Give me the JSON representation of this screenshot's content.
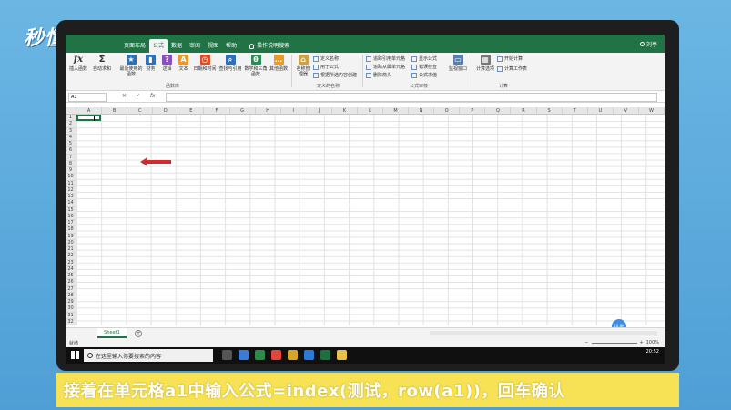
{
  "brand": {
    "logo": "秒懂视频"
  },
  "excel": {
    "tabs": [
      "页面布局",
      "公式",
      "数据",
      "审阅",
      "视图",
      "帮助"
    ],
    "active_tab": "公式",
    "tell_me": "操作说明搜索",
    "user": "刘亭",
    "ribbon": {
      "buttons": [
        {
          "label": "插入函数",
          "icon": "fx-icon"
        },
        {
          "label": "自动求和",
          "icon": "sigma-icon"
        },
        {
          "label": "最近使用的函数",
          "icon": "star-book-icon"
        },
        {
          "label": "财务",
          "icon": "book-icon"
        },
        {
          "label": "逻辑",
          "icon": "question-book-icon"
        },
        {
          "label": "文本",
          "icon": "text-book-icon"
        },
        {
          "label": "日期和时间",
          "icon": "clock-book-icon"
        },
        {
          "label": "查找与引用",
          "icon": "search-book-icon"
        },
        {
          "label": "数学和三角函数",
          "icon": "theta-book-icon"
        },
        {
          "label": "其他函数",
          "icon": "more-book-icon"
        },
        {
          "label": "名称管理器",
          "icon": "tag-icon"
        },
        {
          "label": "监视窗口",
          "icon": "watch-window-icon"
        },
        {
          "label": "计算选项",
          "icon": "calculator-icon"
        }
      ],
      "defined_names": [
        "定义名称",
        "用于公式",
        "根据所选内容创建"
      ],
      "auditing": [
        "追踪引用单元格",
        "追踪从属单元格",
        "删除箭头",
        "显示公式",
        "错误检查",
        "公式求值"
      ],
      "calc": [
        "开始计算",
        "计算工作表"
      ],
      "groups": [
        "函数库",
        "定义的名称",
        "公式审核",
        "计算"
      ]
    },
    "name_box": "A1",
    "columns": [
      "A",
      "B",
      "C",
      "D",
      "E",
      "F",
      "G",
      "H",
      "I",
      "J",
      "K",
      "L",
      "M",
      "N",
      "O",
      "P",
      "Q",
      "R",
      "S",
      "T",
      "U",
      "V",
      "W"
    ],
    "rows": [
      "1",
      "2",
      "3",
      "4",
      "5",
      "6",
      "7",
      "8",
      "9",
      "10",
      "11",
      "12",
      "13",
      "14",
      "15",
      "16",
      "17",
      "18",
      "19",
      "20",
      "21",
      "22",
      "23",
      "24",
      "25",
      "26",
      "27",
      "28",
      "29",
      "30",
      "31",
      "32"
    ],
    "sheet_tab": "Sheet1",
    "status": "就绪",
    "zoom": "100%",
    "float_button": "10.8K"
  },
  "taskbar": {
    "search_placeholder": "在这里输入你要搜索的内容",
    "time": "20:52"
  },
  "caption": "接着在单元格a1中输入公式=index(测试，row(a1))，回车确认",
  "colors": {
    "excel_green": "#217346",
    "caption_bg": "#f7e255",
    "arrow_red": "#d22b2b"
  }
}
